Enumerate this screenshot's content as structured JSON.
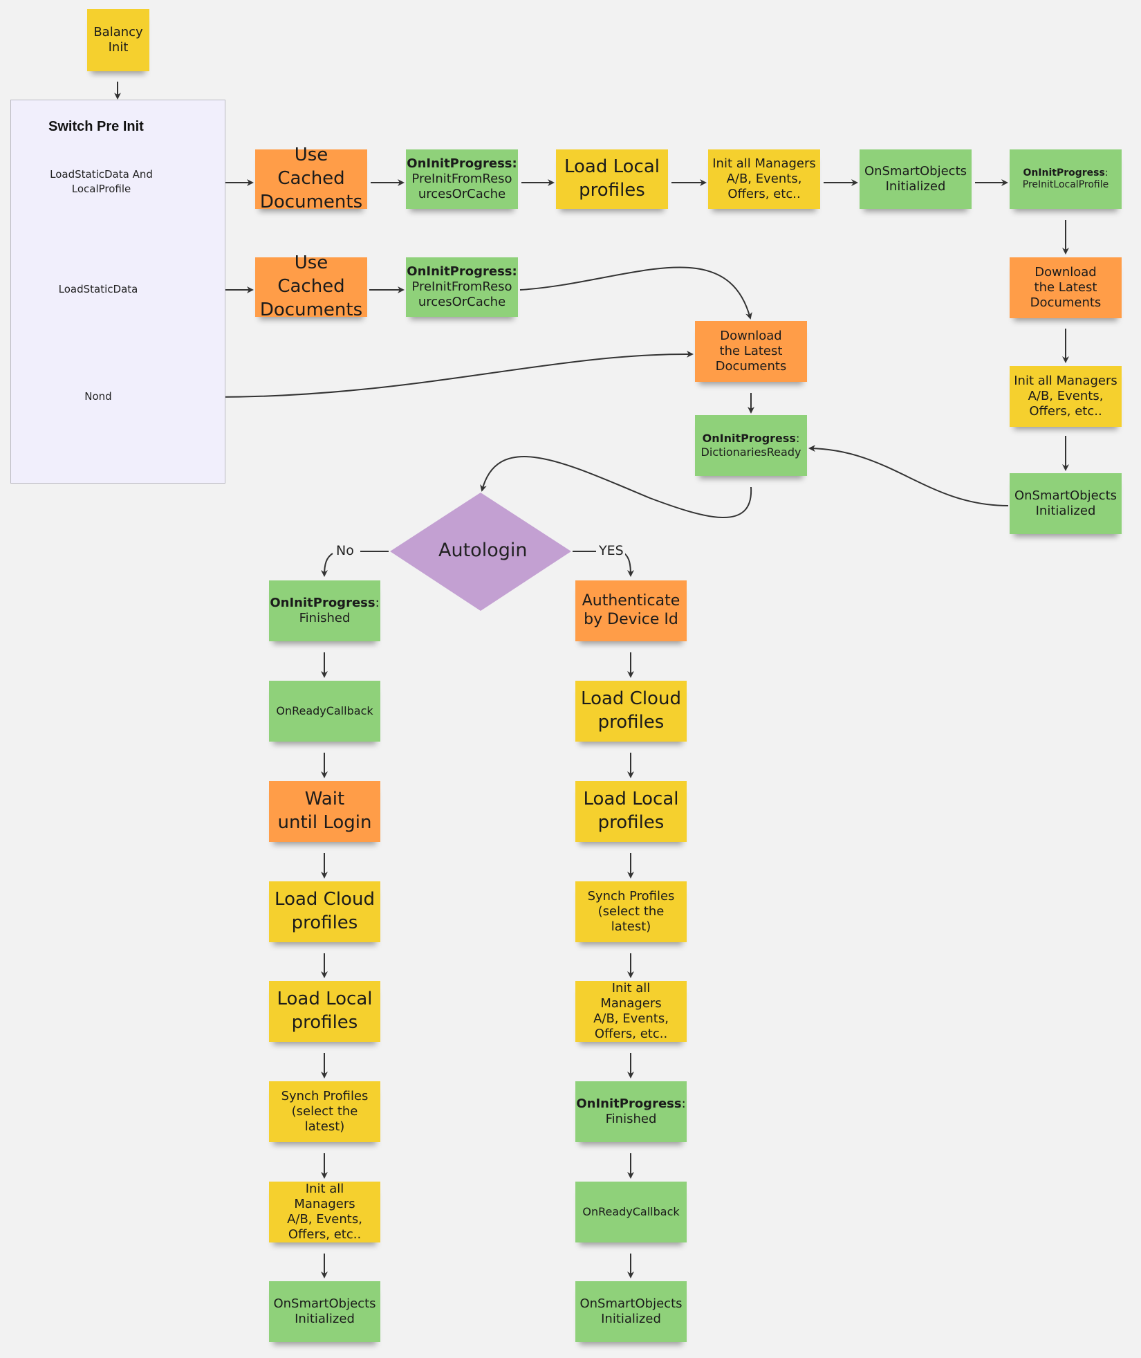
{
  "colors": {
    "yellow": "#f5d02e",
    "orange": "#ff9d48",
    "green": "#8fd17a",
    "purple": "#c3a0d2",
    "frame": "#f1effc",
    "line": "#333333"
  },
  "start": {
    "text": [
      "Balancy",
      "Init"
    ]
  },
  "switch_frame": {
    "title": "Switch Pre Init",
    "options": [
      {
        "label": [
          "LoadStaticData And",
          "LocalProfile"
        ]
      },
      {
        "label": [
          "LoadStaticData"
        ]
      },
      {
        "label": [
          "Nond"
        ]
      }
    ]
  },
  "row1": [
    {
      "color": "orange",
      "text": [
        "Use Cached",
        "Documents"
      ]
    },
    {
      "color": "green",
      "bold": "OnInitProgress:",
      "text": [
        "PreInitFromReso",
        "urcesOrCache"
      ]
    },
    {
      "color": "yellow",
      "text": [
        "Load Local",
        "profiles"
      ]
    },
    {
      "color": "yellow",
      "text": [
        "Init all Managers",
        "A/B, Events,",
        "Offers, etc.."
      ]
    },
    {
      "color": "green",
      "text": [
        "OnSmartObjects",
        "Initialized"
      ]
    },
    {
      "color": "green",
      "bold": "OnInitProgress",
      "text": [
        ":",
        "PreInitLocalProfile"
      ]
    }
  ],
  "row2": [
    {
      "color": "orange",
      "text": [
        "Use Cached",
        "Documents"
      ]
    },
    {
      "color": "green",
      "bold": "OnInitProgress:",
      "text": [
        "PreInitFromReso",
        "urcesOrCache"
      ]
    }
  ],
  "center_column": [
    {
      "color": "orange",
      "text": [
        "Download",
        "the Latest",
        "Documents"
      ]
    },
    {
      "color": "green",
      "bold": "OnInitProgress",
      "text": [
        ":",
        "DictionariesReady"
      ]
    }
  ],
  "right_column": [
    {
      "color": "orange",
      "text": [
        "Download",
        "the Latest",
        "Documents"
      ]
    },
    {
      "color": "yellow",
      "text": [
        "Init all Managers",
        "A/B, Events,",
        "Offers, etc.."
      ]
    },
    {
      "color": "green",
      "text": [
        "OnSmartObjects",
        "Initialized"
      ]
    }
  ],
  "decision": {
    "label": "Autologin",
    "no_label": "No",
    "yes_label": "YES"
  },
  "no_branch": [
    {
      "color": "green",
      "bold": "OnInitProgress",
      "text": [
        ":",
        "Finished"
      ]
    },
    {
      "color": "green",
      "text": [
        "OnReadyCallback"
      ]
    },
    {
      "color": "orange",
      "text": [
        "Wait",
        "until Login"
      ]
    },
    {
      "color": "yellow",
      "text": [
        "Load Cloud",
        "profiles"
      ]
    },
    {
      "color": "yellow",
      "text": [
        "Load Local",
        "profiles"
      ]
    },
    {
      "color": "yellow",
      "text": [
        "Synch Profiles",
        "(select the latest)"
      ]
    },
    {
      "color": "yellow",
      "text": [
        "Init all Managers",
        "A/B, Events,",
        "Offers, etc.."
      ]
    },
    {
      "color": "green",
      "text": [
        "OnSmartObjects",
        "Initialized"
      ]
    }
  ],
  "yes_branch": [
    {
      "color": "orange",
      "text": [
        "Authenticate",
        "by Device Id"
      ]
    },
    {
      "color": "yellow",
      "text": [
        "Load Cloud",
        "profiles"
      ]
    },
    {
      "color": "yellow",
      "text": [
        "Load Local",
        "profiles"
      ]
    },
    {
      "color": "yellow",
      "text": [
        "Synch Profiles",
        "(select the latest)"
      ]
    },
    {
      "color": "yellow",
      "text": [
        "Init all Managers",
        "A/B, Events,",
        "Offers, etc.."
      ]
    },
    {
      "color": "green",
      "bold": "OnInitProgress",
      "text": [
        ":",
        "Finished"
      ]
    },
    {
      "color": "green",
      "text": [
        "OnReadyCallback"
      ]
    },
    {
      "color": "green",
      "text": [
        "OnSmartObjects",
        "Initialized"
      ]
    }
  ]
}
